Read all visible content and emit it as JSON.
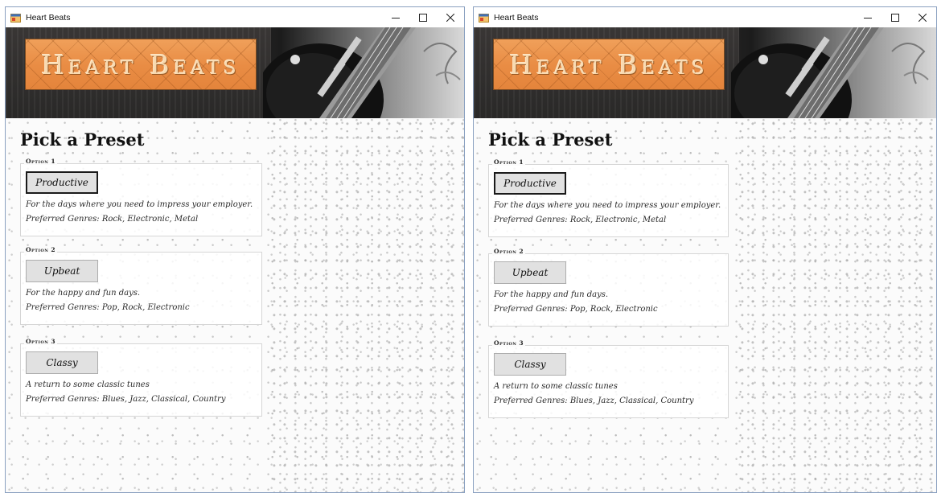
{
  "window": {
    "title": "Heart Beats",
    "controls": {
      "minimize": "–",
      "maximize": "☐",
      "close": "✕"
    }
  },
  "banner": {
    "logo_text": "Heart Beats"
  },
  "page": {
    "heading": "Pick a Preset",
    "options": [
      {
        "legend": "Option 1",
        "button": "Productive",
        "description": "For the days where you need to impress your employer.",
        "genres": "Preferred Genres: Rock, Electronic, Metal"
      },
      {
        "legend": "Option 2",
        "button": "Upbeat",
        "description": "For the happy and fun days.",
        "genres": "Preferred Genres: Pop, Rock, Electronic"
      },
      {
        "legend": "Option 3",
        "button": "Classy",
        "description": "A return to some classic tunes",
        "genres": "Preferred Genres: Blues, Jazz, Classical, Country"
      }
    ]
  },
  "icons": {
    "app": "app-window-icon",
    "minimize": "minimize-icon",
    "maximize": "maximize-icon",
    "close": "close-icon"
  }
}
